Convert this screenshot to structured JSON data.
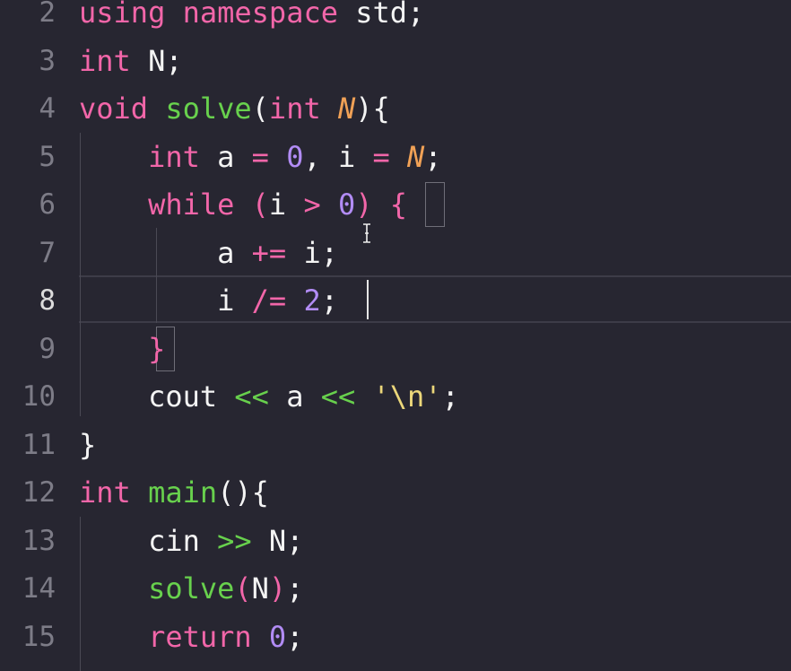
{
  "colors": {
    "background": "#272631",
    "keyword": "#f266a9",
    "function": "#68d14d",
    "number": "#b28cf5",
    "parameter": "#f0a156",
    "string": "#ecd77a",
    "text": "#f4f4f4",
    "line_number": "#7d7c87"
  },
  "editor": {
    "current_line": "8",
    "lines": [
      {
        "number": "2",
        "tokens": [
          {
            "t": "using",
            "cls": "k"
          },
          {
            "t": " ",
            "cls": "c"
          },
          {
            "t": "namespace",
            "cls": "k"
          },
          {
            "t": " std;",
            "cls": "c"
          }
        ]
      },
      {
        "number": "3",
        "tokens": [
          {
            "t": "int",
            "cls": "k"
          },
          {
            "t": " N;",
            "cls": "c"
          }
        ]
      },
      {
        "number": "4",
        "tokens": [
          {
            "t": "void",
            "cls": "k"
          },
          {
            "t": " ",
            "cls": "c"
          },
          {
            "t": "solve",
            "cls": "f"
          },
          {
            "t": "(",
            "cls": "c"
          },
          {
            "t": "int",
            "cls": "k"
          },
          {
            "t": " ",
            "cls": "c"
          },
          {
            "t": "N",
            "cls": "p"
          },
          {
            "t": "){",
            "cls": "c"
          }
        ]
      },
      {
        "number": "5",
        "tokens": [
          {
            "t": "    ",
            "cls": "c"
          },
          {
            "t": "int",
            "cls": "k"
          },
          {
            "t": " a ",
            "cls": "c"
          },
          {
            "t": "=",
            "cls": "o"
          },
          {
            "t": " ",
            "cls": "c"
          },
          {
            "t": "0",
            "cls": "n"
          },
          {
            "t": ", i ",
            "cls": "c"
          },
          {
            "t": "=",
            "cls": "o"
          },
          {
            "t": " ",
            "cls": "c"
          },
          {
            "t": "N",
            "cls": "p"
          },
          {
            "t": ";",
            "cls": "c"
          }
        ]
      },
      {
        "number": "6",
        "tokens": [
          {
            "t": "    ",
            "cls": "c"
          },
          {
            "t": "while",
            "cls": "k"
          },
          {
            "t": " ",
            "cls": "c"
          },
          {
            "t": "(",
            "cls": "k"
          },
          {
            "t": "i ",
            "cls": "c"
          },
          {
            "t": ">",
            "cls": "o"
          },
          {
            "t": " ",
            "cls": "c"
          },
          {
            "t": "0",
            "cls": "n"
          },
          {
            "t": ")",
            "cls": "k"
          },
          {
            "t": " ",
            "cls": "c"
          },
          {
            "t": "{",
            "cls": "k"
          }
        ]
      },
      {
        "number": "7",
        "tokens": [
          {
            "t": "        a ",
            "cls": "c"
          },
          {
            "t": "+=",
            "cls": "o"
          },
          {
            "t": " i;",
            "cls": "c"
          }
        ]
      },
      {
        "number": "8",
        "tokens": [
          {
            "t": "        i ",
            "cls": "c"
          },
          {
            "t": "/=",
            "cls": "o"
          },
          {
            "t": " ",
            "cls": "c"
          },
          {
            "t": "2",
            "cls": "n"
          },
          {
            "t": ";",
            "cls": "c"
          }
        ]
      },
      {
        "number": "9",
        "tokens": [
          {
            "t": "    ",
            "cls": "c"
          },
          {
            "t": "}",
            "cls": "k"
          }
        ]
      },
      {
        "number": "10",
        "tokens": [
          {
            "t": "    cout ",
            "cls": "c"
          },
          {
            "t": "<<",
            "cls": "f"
          },
          {
            "t": " a ",
            "cls": "c"
          },
          {
            "t": "<<",
            "cls": "f"
          },
          {
            "t": " ",
            "cls": "c"
          },
          {
            "t": "'\\n'",
            "cls": "s"
          },
          {
            "t": ";",
            "cls": "c"
          }
        ]
      },
      {
        "number": "11",
        "tokens": [
          {
            "t": "}",
            "cls": "c"
          }
        ]
      },
      {
        "number": "12",
        "tokens": [
          {
            "t": "int",
            "cls": "k"
          },
          {
            "t": " ",
            "cls": "c"
          },
          {
            "t": "main",
            "cls": "f"
          },
          {
            "t": "(){",
            "cls": "c"
          }
        ]
      },
      {
        "number": "13",
        "tokens": [
          {
            "t": "    cin ",
            "cls": "c"
          },
          {
            "t": ">>",
            "cls": "f"
          },
          {
            "t": " N;",
            "cls": "c"
          }
        ]
      },
      {
        "number": "14",
        "tokens": [
          {
            "t": "    ",
            "cls": "c"
          },
          {
            "t": "solve",
            "cls": "f"
          },
          {
            "t": "(",
            "cls": "k"
          },
          {
            "t": "N",
            "cls": "c"
          },
          {
            "t": ")",
            "cls": "k"
          },
          {
            "t": ";",
            "cls": "c"
          }
        ]
      },
      {
        "number": "15",
        "tokens": [
          {
            "t": "    ",
            "cls": "c"
          },
          {
            "t": "return",
            "cls": "k"
          },
          {
            "t": " ",
            "cls": "c"
          },
          {
            "t": "0",
            "cls": "n"
          },
          {
            "t": ";",
            "cls": "c"
          }
        ]
      }
    ]
  }
}
